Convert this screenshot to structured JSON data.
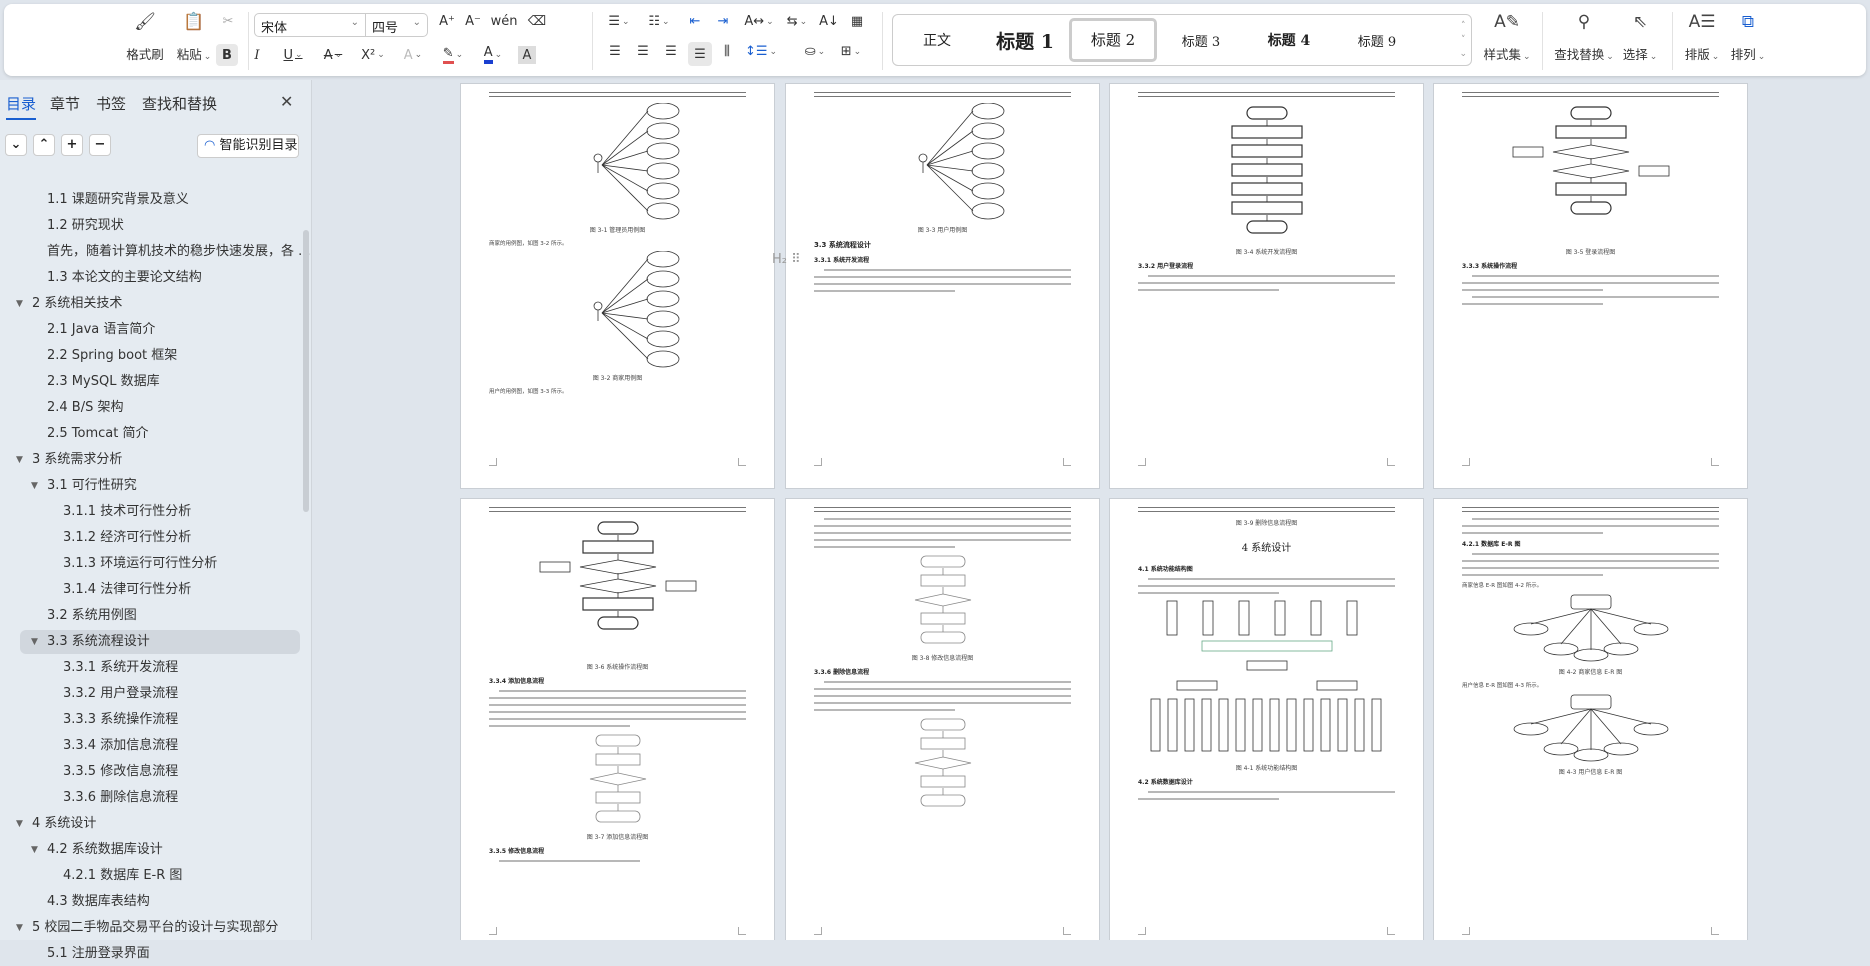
{
  "toolbar": {
    "format_painter": "格式刷",
    "paste": "粘贴",
    "font": "宋体",
    "font_size": "四号",
    "styles": [
      "正文",
      "标题 1",
      "标题 2",
      "标题 3",
      "标题 4",
      "标题 9"
    ],
    "style_selected": "标题 2",
    "style_set": "样式集",
    "find_replace": "查找替换",
    "select": "选择",
    "layout": "排版",
    "arrange": "排列",
    "font_color": "#1a3fd0",
    "highlight_color": "#e05050"
  },
  "sidebar": {
    "tabs": [
      "目录",
      "章节",
      "书签",
      "查找和替换"
    ],
    "active_tab": "目录",
    "smart_toc": "智能识别目录",
    "items": [
      {
        "label": "1.1 课题研究背景及意义",
        "level": 2
      },
      {
        "label": "1.2 研究现状",
        "level": 2
      },
      {
        "label": "首先，随着计算机技术的稳步快速发展，各 ...",
        "level": 2
      },
      {
        "label": "1.3 本论文的主要论文结构",
        "level": 2
      },
      {
        "label": "2 系统相关技术",
        "level": 1,
        "expanded": true
      },
      {
        "label": "2.1 Java 语言简介",
        "level": 2
      },
      {
        "label": "2.2    Spring boot 框架",
        "level": 2
      },
      {
        "label": "2.3 MySQL 数据库",
        "level": 2
      },
      {
        "label": "2.4 B/S 架构",
        "level": 2
      },
      {
        "label": "2.5 Tomcat 简介",
        "level": 2
      },
      {
        "label": "3 系统需求分析",
        "level": 1,
        "expanded": true
      },
      {
        "label": "3.1 可行性研究",
        "level": 2,
        "expanded": true
      },
      {
        "label": "3.1.1 技术可行性分析",
        "level": 3
      },
      {
        "label": "3.1.2  经济可行性分析",
        "level": 3
      },
      {
        "label": "3.1.3  环境运行可行性分析",
        "level": 3
      },
      {
        "label": "3.1.4  法律可行性分析",
        "level": 3
      },
      {
        "label": "3.2 系统用例图",
        "level": 2
      },
      {
        "label": "3.3 系统流程设计",
        "level": 2,
        "expanded": true,
        "selected": true
      },
      {
        "label": "3.3.1  系统开发流程",
        "level": 3
      },
      {
        "label": "3.3.2  用户登录流程",
        "level": 3
      },
      {
        "label": "3.3.3  系统操作流程",
        "level": 3
      },
      {
        "label": "3.3.4  添加信息流程",
        "level": 3
      },
      {
        "label": "3.3.5  修改信息流程",
        "level": 3
      },
      {
        "label": "3.3.6  删除信息流程",
        "level": 3
      },
      {
        "label": "4 系统设计",
        "level": 1,
        "expanded": true
      },
      {
        "label": "4.2 系统数据库设计",
        "level": 2,
        "expanded": true
      },
      {
        "label": "4.2.1 数据库 E-R 图",
        "level": 3
      },
      {
        "label": "4.3 数据库表结构",
        "level": 2
      },
      {
        "label": "5  校园二手物品交易平台的设计与实现部分",
        "level": 1,
        "expanded": true
      },
      {
        "label": "5.1 注册登录界面",
        "level": 2
      }
    ]
  },
  "pages": [
    {
      "blocks": [
        {
          "t": "diagram",
          "k": "usecase"
        },
        {
          "t": "cap",
          "v": "图 3-1 管理员用例图"
        },
        {
          "t": "txt",
          "v": "商家的用例图，如图 3-2 所示。"
        },
        {
          "t": "diagram",
          "k": "usecase"
        },
        {
          "t": "cap",
          "v": "图 3-2 商家用例图"
        },
        {
          "t": "txt",
          "v": "用户的用例图，如图 3-3 所示。"
        }
      ]
    },
    {
      "blocks": [
        {
          "t": "diagram",
          "k": "usecase"
        },
        {
          "t": "cap",
          "v": "图 3-3 用户用例图"
        },
        {
          "t": "h2",
          "v": "3.3 系统流程设计"
        },
        {
          "t": "sub",
          "v": "3.3.1 系统开发流程"
        },
        {
          "t": "para",
          "n": 4
        }
      ]
    },
    {
      "blocks": [
        {
          "t": "diagram",
          "k": "flow"
        },
        {
          "t": "cap",
          "v": "图 3-4 系统开发流程图"
        },
        {
          "t": "sub",
          "v": "3.3.2 用户登录流程"
        },
        {
          "t": "para",
          "n": 3
        }
      ]
    },
    {
      "blocks": [
        {
          "t": "diagram",
          "k": "flow2"
        },
        {
          "t": "cap",
          "v": "图 3-5 登录流程图"
        },
        {
          "t": "sub",
          "v": "3.3.3 系统操作流程"
        },
        {
          "t": "para",
          "n": 3
        },
        {
          "t": "para",
          "n": 2
        }
      ]
    },
    {
      "blocks": [
        {
          "t": "diagram",
          "k": "flow2"
        },
        {
          "t": "cap",
          "v": "图 3-6 系统操作流程图"
        },
        {
          "t": "sub",
          "v": "3.3.4 添加信息流程"
        },
        {
          "t": "para",
          "n": 6
        },
        {
          "t": "diagram",
          "k": "flowsm"
        },
        {
          "t": "cap",
          "v": "图 3-7 添加信息流程图"
        },
        {
          "t": "sub",
          "v": "3.3.5 修改信息流程"
        },
        {
          "t": "para",
          "n": 1
        }
      ]
    },
    {
      "blocks": [
        {
          "t": "para",
          "n": 5
        },
        {
          "t": "diagram",
          "k": "flowsm"
        },
        {
          "t": "cap",
          "v": "图 3-8 修改信息流程图"
        },
        {
          "t": "sub",
          "v": "3.3.6 删除信息流程"
        },
        {
          "t": "para",
          "n": 5
        },
        {
          "t": "diagram",
          "k": "flowsm"
        }
      ]
    },
    {
      "blocks": [
        {
          "t": "cap",
          "v": "图 3-9 删除信息流程图"
        },
        {
          "t": "chap",
          "v": "4 系统设计"
        },
        {
          "t": "sub",
          "v": "4.1 系统功能结构图"
        },
        {
          "t": "para",
          "n": 3
        },
        {
          "t": "diagram",
          "k": "struct"
        },
        {
          "t": "cap",
          "v": "图 4-1 系统功能结构图"
        },
        {
          "t": "sub",
          "v": "4.2 系统数据库设计"
        },
        {
          "t": "para",
          "n": 2
        }
      ]
    },
    {
      "blocks": [
        {
          "t": "para",
          "n": 3
        },
        {
          "t": "sub",
          "v": "4.2.1 数据库 E-R 图"
        },
        {
          "t": "para",
          "n": 4
        },
        {
          "t": "txt",
          "v": "商家信息 E-R 图如图 4-2 所示。"
        },
        {
          "t": "diagram",
          "k": "er"
        },
        {
          "t": "cap",
          "v": "图 4-2 商家信息 E-R 图"
        },
        {
          "t": "txt",
          "v": "用户信息 E-R 图如图 4-3 所示。"
        },
        {
          "t": "diagram",
          "k": "er"
        },
        {
          "t": "cap",
          "v": "图 4-3 用户信息 E-R 图"
        }
      ]
    }
  ]
}
